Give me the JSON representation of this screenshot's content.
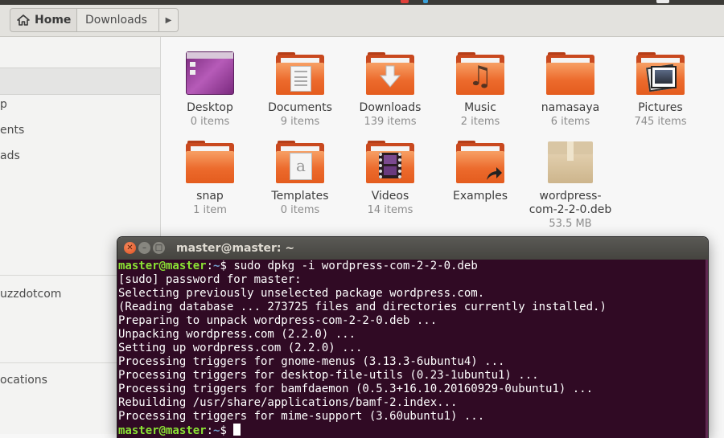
{
  "header": {
    "breadcrumb": {
      "home": "Home",
      "current": "Downloads"
    }
  },
  "colors": {
    "accent": "#e95420",
    "terminal_bg": "#300a24",
    "prompt_user": "#8ae234",
    "prompt_path": "#729fcf"
  },
  "sidebar": {
    "items": [
      {
        "label": "p",
        "icon": "recent-icon"
      },
      {
        "label": "ents",
        "icon": "documents-icon"
      },
      {
        "label": "ads",
        "icon": "downloads-icon"
      },
      {
        "label": "uzzdotcom",
        "icon": "network-icon"
      },
      {
        "label": "ocations",
        "icon": "other-locations-icon"
      }
    ]
  },
  "files": [
    {
      "name": "Desktop",
      "count": "0 items",
      "icon": "desktop-folder-icon"
    },
    {
      "name": "Documents",
      "count": "9 items",
      "icon": "documents-folder-icon"
    },
    {
      "name": "Downloads",
      "count": "139 items",
      "icon": "downloads-folder-icon"
    },
    {
      "name": "Music",
      "count": "2 items",
      "icon": "music-folder-icon"
    },
    {
      "name": "namasaya",
      "count": "6 items",
      "icon": "folder-icon"
    },
    {
      "name": "Pictures",
      "count": "745 items",
      "icon": "pictures-folder-icon"
    },
    {
      "name": "snap",
      "count": "1 item",
      "icon": "folder-icon"
    },
    {
      "name": "Templates",
      "count": "0 items",
      "icon": "templates-folder-icon"
    },
    {
      "name": "Videos",
      "count": "14 items",
      "icon": "videos-folder-icon"
    },
    {
      "name": "Examples",
      "count": "",
      "icon": "examples-link-folder-icon"
    },
    {
      "name": "wordpress-com-2-2-0.deb",
      "name_line1": "wordpress-",
      "name_line2": "com-2-2-0.deb",
      "count": "53.5 MB",
      "icon": "package-icon"
    }
  ],
  "terminal": {
    "title": "master@master: ~",
    "prompt_user": "master@master",
    "prompt_sep": ":",
    "prompt_path": "~",
    "prompt_end": "$ ",
    "command": "sudo dpkg -i wordpress-com-2-2-0.deb",
    "output": [
      "[sudo] password for master:",
      "Selecting previously unselected package wordpress.com.",
      "(Reading database ... 273725 files and directories currently installed.)",
      "Preparing to unpack wordpress-com-2-2-0.deb ...",
      "Unpacking wordpress.com (2.2.0) ...",
      "Setting up wordpress.com (2.2.0) ...",
      "Processing triggers for gnome-menus (3.13.3-6ubuntu4) ...",
      "Processing triggers for desktop-file-utils (0.23-1ubuntu1) ...",
      "Processing triggers for bamfdaemon (0.5.3+16.10.20160929-0ubuntu1) ...",
      "Rebuilding /usr/share/applications/bamf-2.index...",
      "Processing triggers for mime-support (3.60ubuntu1) ..."
    ]
  }
}
